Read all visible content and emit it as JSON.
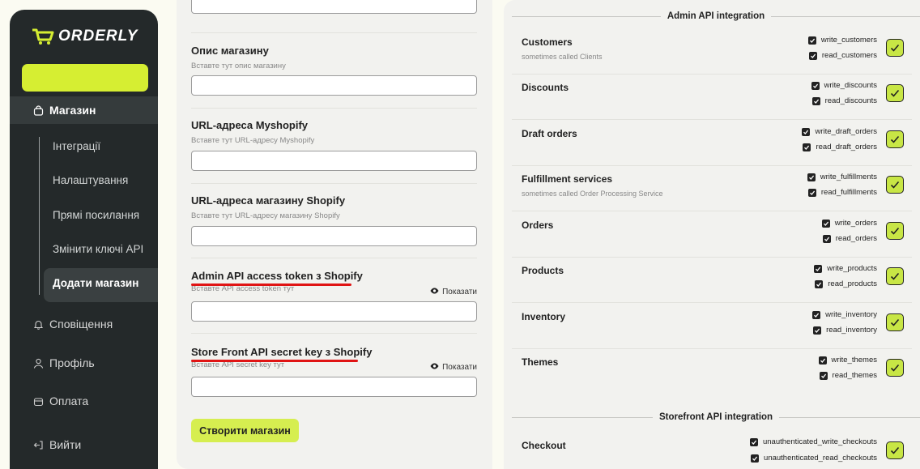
{
  "sidebar": {
    "logo_text": "ORDERLY",
    "shop_label": "Магазин",
    "sub_items": [
      "Інтеграції",
      "Налаштування",
      "Прямі посилання",
      "Змінити ключі API"
    ],
    "active_sub": "Додати магазин",
    "notifications_label": "Сповіщення",
    "profile_label": "Профіль",
    "payment_label": "Оплата",
    "logout_label": "Вийти",
    "accent_color": "#d6ee32"
  },
  "form": {
    "desc_title": "Опис магазину",
    "desc_hint": "Вставте тут опис магазину",
    "myshopify_title": "URL-адреса Myshopify",
    "myshopify_hint": "Вставте тут URL-адресу Myshopify",
    "shop_url_title": "URL-адреса магазину Shopify",
    "shop_url_hint": "Вставте тут URL-адресу магазину Shopify",
    "admin_token_title": "Admin API access token з Shopify",
    "admin_token_hint": "Вставте API access token тут",
    "storefront_title": "Store Front API secret key з Shopify",
    "storefront_hint": "Вставте API secret key тут",
    "show_label": "Показати",
    "create_button": "Створити магазин"
  },
  "integration": {
    "admin_header": "Admin API integration",
    "storefront_header": "Storefront API integration",
    "permissions": [
      {
        "name": "Customers",
        "sub": "sometimes called Clients",
        "write": "write_customers",
        "read": "read_customers"
      },
      {
        "name": "Discounts",
        "sub": "",
        "write": "write_discounts",
        "read": "read_discounts"
      },
      {
        "name": "Draft orders",
        "sub": "",
        "write": "write_draft_orders",
        "read": "read_draft_orders"
      },
      {
        "name": "Fulfillment services",
        "sub": "sometimes called Order Processing Service",
        "write": "write_fulfillments",
        "read": "read_fulfillments"
      },
      {
        "name": "Orders",
        "sub": "",
        "write": "write_orders",
        "read": "read_orders"
      },
      {
        "name": "Products",
        "sub": "",
        "write": "write_products",
        "read": "read_products"
      },
      {
        "name": "Inventory",
        "sub": "",
        "write": "write_inventory",
        "read": "read_inventory"
      },
      {
        "name": "Themes",
        "sub": "",
        "write": "write_themes",
        "read": "read_themes"
      }
    ],
    "checkout": {
      "name": "Checkout",
      "write": "unauthenticated_write_checkouts",
      "read": "unauthenticated_read_checkouts"
    }
  }
}
